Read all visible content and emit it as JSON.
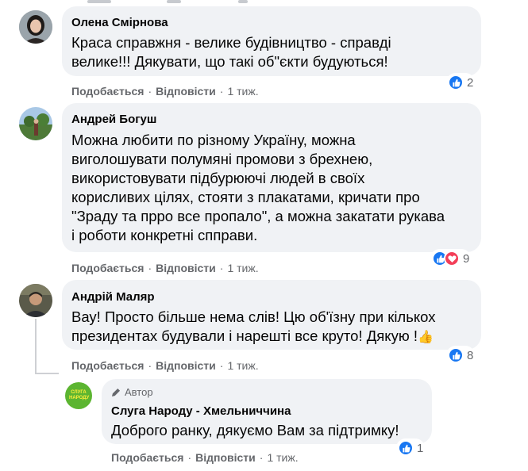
{
  "comments": [
    {
      "author": "Олена Смірнова",
      "lines": [
        "Краса справжня - велике будівництво - справді",
        "велике!!! Дякувати, що такі об\"єкти будуються!"
      ],
      "like_label": "Подобається",
      "reply_label": "Відповісти",
      "time": "1 тиж.",
      "reaction_count": "2",
      "reactions": [
        "like-icon"
      ]
    },
    {
      "author": "Андрей Богуш",
      "lines": [
        "Можна любити по різному Україну, можна",
        "виголошувати полумяні промови з брехнею,",
        "використовувати підбурюючі людей в своїх",
        "корисливих цілях, стояти з плакатами, кричати про",
        "\"Зраду та прро все пропало\", а можна закатати рукава",
        "і роботи конкретні спправи."
      ],
      "like_label": "Подобається",
      "reply_label": "Відповісти",
      "time": "1 тиж.",
      "reaction_count": "9",
      "reactions": [
        "like-icon",
        "love-icon"
      ]
    },
    {
      "author": "Андрій Маляр",
      "lines": [
        "Вау! Просто більше нема слів! Цю об'їзну при кількох",
        "президентах будували і нарешті все круто! Дякую !"
      ],
      "emoji": "👍",
      "like_label": "Подобається",
      "reply_label": "Відповісти",
      "time": "1 тиж.",
      "reaction_count": "8",
      "reactions": [
        "like-icon"
      ]
    }
  ],
  "reply": {
    "badge": "Автор",
    "author": "Слуга Народу - Хмельниччина",
    "avatar_text": "СЛУГА НАРОДУ",
    "text": "Доброго ранку, дякуємо Вам за підтримку!",
    "like_label": "Подобається",
    "reply_label": "Відповісти",
    "time": "1 тиж.",
    "reaction_count": "1",
    "reactions": [
      "like-icon"
    ]
  },
  "colors": {
    "bubble": "#f0f2f5",
    "like_blue": "#1877f2",
    "love_red": "#f33e58",
    "brand_green": "#5cb531",
    "meta_gray": "#65676b"
  }
}
